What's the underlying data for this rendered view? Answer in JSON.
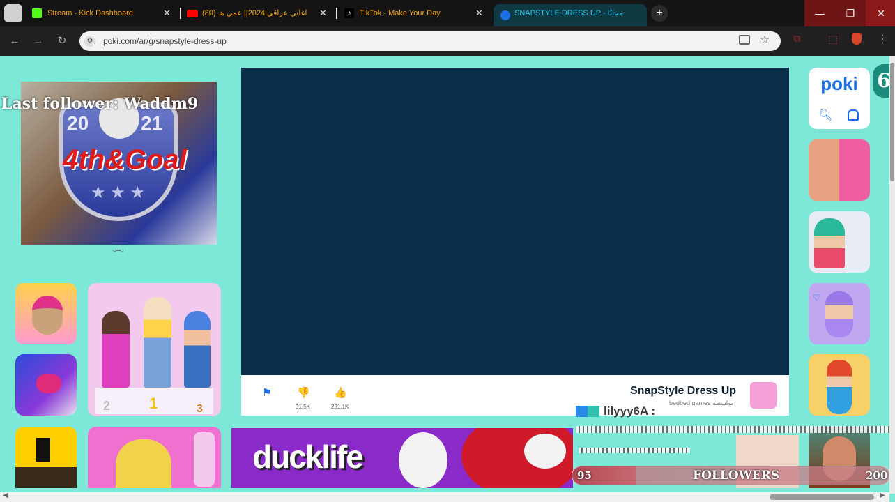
{
  "tabs": [
    {
      "label": "Stream - Kick Dashboard",
      "icon": "kick-icon",
      "close": "✕"
    },
    {
      "label": "(80) اغاني عراقي|2024|| عمي هـ",
      "icon": "youtube-icon",
      "close": "✕"
    },
    {
      "label": "TikTok - Make Your Day",
      "icon": "tiktok-icon",
      "close": "✕"
    },
    {
      "label": "SNAPSTYLE DRESS UP - ‏مجانًا",
      "icon": "poki-favicon-icon",
      "close": ""
    }
  ],
  "new_tab": "+",
  "window_controls": {
    "minimize": "—",
    "maximize": "❐",
    "close": "✕"
  },
  "address_bar": {
    "url": "poki.com/ar/g/snapstyle-dress-up"
  },
  "overlay": {
    "last_follower": "Last follower: Waddm9",
    "followers_label": "FOLLOWERS",
    "followers_current": "95",
    "followers_goal": "200",
    "chat_user": "lilyyy6A :",
    "corner_badge": "6"
  },
  "promo": {
    "year_left": "20",
    "year_right": "21",
    "title": "4th&Goal",
    "caption": "زمني"
  },
  "game": {
    "title": "SnapStyle Dress Up",
    "developer": "bedbed games بواسطة",
    "dislikes": "31.5K",
    "likes": "281.1K"
  },
  "bottom": {
    "ducklife": "ducklife"
  },
  "left_tiles": {
    "podium_1": "1",
    "podium_2": "2",
    "podium_3": "3"
  },
  "poki": {
    "logo": "poki"
  },
  "colors": {
    "page_bg": "#7ee8d8",
    "stage_bg": "#0a2d4a",
    "tab_text": "#f0a21a",
    "accent": "#1b6ee8"
  }
}
